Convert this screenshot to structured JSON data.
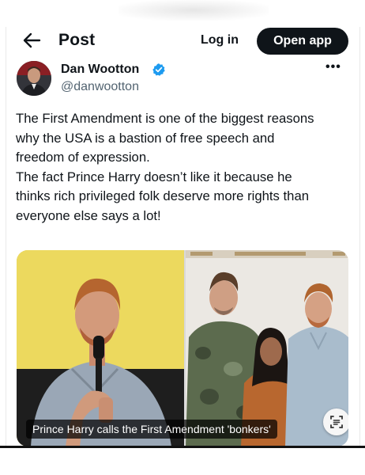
{
  "header": {
    "title": "Post",
    "login_label": "Log in",
    "open_app_label": "Open app"
  },
  "tweet": {
    "author_name": "Dan Wootton",
    "handle": "@danwootton",
    "verified": true,
    "text_lines": [
      "The First Amendment is one of the biggest reasons",
      "why the USA is a bastion of free speech and",
      "freedom of expression.",
      "The fact Prince Harry doesn’t like it because he",
      "thinks rich privileged folk deserve more rights than",
      "everyone else says a lot!"
    ],
    "media": {
      "caption": "Prince Harry calls the First Amendment 'bonkers'"
    }
  },
  "icons": {
    "back": "arrow-left-icon",
    "verified": "verified-badge-icon",
    "more": "more-horizontal-icon",
    "ocr": "text-scan-icon"
  },
  "colors": {
    "text": "#0f1419",
    "secondary_text": "#536471",
    "verified_blue": "#1d9bf0",
    "button_dark": "#0f1419"
  }
}
